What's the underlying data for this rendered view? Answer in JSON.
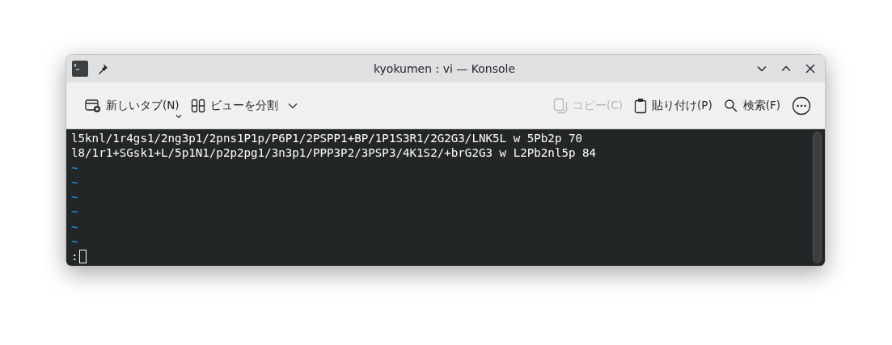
{
  "window": {
    "title": "kyokumen : vi — Konsole"
  },
  "toolbar": [
    {
      "kind": "new-tab",
      "label": "新しいタブ(N)",
      "disabled": false,
      "menu": true
    },
    {
      "kind": "split",
      "label": "ビューを分割",
      "disabled": false,
      "menu": true
    },
    {
      "kind": "spacer"
    },
    {
      "kind": "copy",
      "label": "コピー(C)",
      "disabled": true,
      "menu": false
    },
    {
      "kind": "paste",
      "label": "貼り付け(P)",
      "disabled": false,
      "menu": false
    },
    {
      "kind": "search",
      "label": "検索(F)",
      "disabled": false,
      "menu": false
    },
    {
      "kind": "more",
      "disabled": false,
      "menu": false
    }
  ],
  "terminal": {
    "lines": [
      "l5knl/1r4gs1/2ng3p1/2pns1P1p/P6P1/2PSPP1+BP/1P1S3R1/2G2G3/LNK5L w 5Pb2p 70",
      "l8/1r1+SGsk1+L/5p1N1/p2p2pg1/3n3p1/PPP3P2/3PSP3/4K1S2/+brG2G3 w L2Pb2nl5p 84"
    ],
    "empty_lines": [
      "~",
      "~",
      "~",
      "~",
      "~",
      "~"
    ],
    "command_line": ":"
  }
}
